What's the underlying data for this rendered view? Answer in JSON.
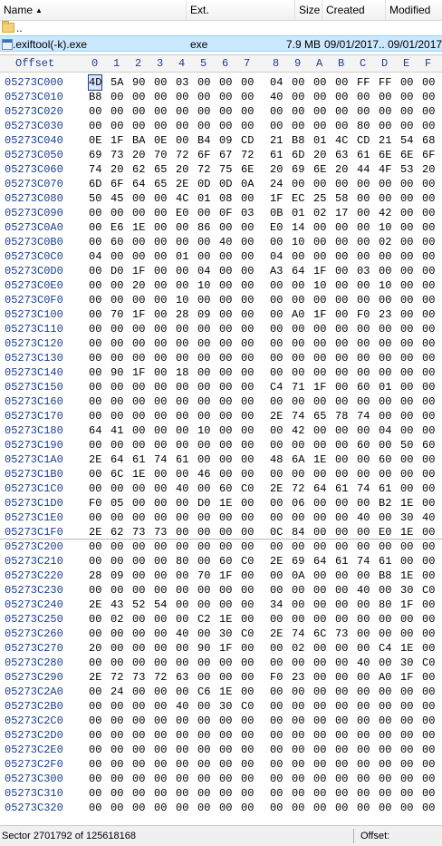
{
  "file_list": {
    "columns": {
      "name": "Name",
      "ext": "Ext.",
      "size": "Size",
      "created": "Created",
      "modified": "Modified"
    },
    "up_row": {
      "name": ".."
    },
    "selected": {
      "name": ".exiftool(-k).exe",
      "ext": "exe",
      "size": "7.9 MB",
      "created": "09/01/2017...",
      "modified": "09/01/2017..."
    }
  },
  "hex": {
    "offset_label": "Offset",
    "columns": [
      "0",
      "1",
      "2",
      "3",
      "4",
      "5",
      "6",
      "7",
      "8",
      "9",
      "A",
      "B",
      "C",
      "D",
      "E",
      "F"
    ],
    "rows": [
      [
        "05273C000",
        "4D 5A 90 00 03 00 00 00 04 00 00 00 FF FF 00 00"
      ],
      [
        "05273C010",
        "B8 00 00 00 00 00 00 00 40 00 00 00 00 00 00 00"
      ],
      [
        "05273C020",
        "00 00 00 00 00 00 00 00 00 00 00 00 00 00 00 00"
      ],
      [
        "05273C030",
        "00 00 00 00 00 00 00 00 00 00 00 00 80 00 00 00"
      ],
      [
        "05273C040",
        "0E 1F BA 0E 00 B4 09 CD 21 B8 01 4C CD 21 54 68"
      ],
      [
        "05273C050",
        "69 73 20 70 72 6F 67 72 61 6D 20 63 61 6E 6E 6F"
      ],
      [
        "05273C060",
        "74 20 62 65 20 72 75 6E 20 69 6E 20 44 4F 53 20"
      ],
      [
        "05273C070",
        "6D 6F 64 65 2E 0D 0D 0A 24 00 00 00 00 00 00 00"
      ],
      [
        "05273C080",
        "50 45 00 00 4C 01 08 00 1F EC 25 58 00 00 00 00"
      ],
      [
        "05273C090",
        "00 00 00 00 E0 00 0F 03 0B 01 02 17 00 42 00 00"
      ],
      [
        "05273C0A0",
        "00 E6 1E 00 00 86 00 00 E0 14 00 00 00 10 00 00"
      ],
      [
        "05273C0B0",
        "00 60 00 00 00 00 40 00 00 10 00 00 00 02 00 00"
      ],
      [
        "05273C0C0",
        "04 00 00 00 01 00 00 00 04 00 00 00 00 00 00 00"
      ],
      [
        "05273C0D0",
        "00 D0 1F 00 00 04 00 00 A3 64 1F 00 03 00 00 00"
      ],
      [
        "05273C0E0",
        "00 00 20 00 00 10 00 00 00 00 10 00 00 10 00 00"
      ],
      [
        "05273C0F0",
        "00 00 00 00 10 00 00 00 00 00 00 00 00 00 00 00"
      ],
      [
        "05273C100",
        "00 70 1F 00 28 09 00 00 00 A0 1F 00 F0 23 00 00"
      ],
      [
        "05273C110",
        "00 00 00 00 00 00 00 00 00 00 00 00 00 00 00 00"
      ],
      [
        "05273C120",
        "00 00 00 00 00 00 00 00 00 00 00 00 00 00 00 00"
      ],
      [
        "05273C130",
        "00 00 00 00 00 00 00 00 00 00 00 00 00 00 00 00"
      ],
      [
        "05273C140",
        "00 90 1F 00 18 00 00 00 00 00 00 00 00 00 00 00"
      ],
      [
        "05273C150",
        "00 00 00 00 00 00 00 00 C4 71 1F 00 60 01 00 00"
      ],
      [
        "05273C160",
        "00 00 00 00 00 00 00 00 00 00 00 00 00 00 00 00"
      ],
      [
        "05273C170",
        "00 00 00 00 00 00 00 00 2E 74 65 78 74 00 00 00"
      ],
      [
        "05273C180",
        "64 41 00 00 00 10 00 00 00 42 00 00 00 04 00 00"
      ],
      [
        "05273C190",
        "00 00 00 00 00 00 00 00 00 00 00 00 60 00 50 60"
      ],
      [
        "05273C1A0",
        "2E 64 61 74 61 00 00 00 48 6A 1E 00 00 60 00 00"
      ],
      [
        "05273C1B0",
        "00 6C 1E 00 00 46 00 00 00 00 00 00 00 00 00 00"
      ],
      [
        "05273C1C0",
        "00 00 00 00 40 00 60 C0 2E 72 64 61 74 61 00 00"
      ],
      [
        "05273C1D0",
        "F0 05 00 00 00 D0 1E 00 00 06 00 00 00 B2 1E 00"
      ],
      [
        "05273C1E0",
        "00 00 00 00 00 00 00 00 00 00 00 00 40 00 30 40"
      ],
      [
        "05273C1F0",
        "2E 62 73 73 00 00 00 00 0C 84 00 00 00 E0 1E 00"
      ],
      [
        "05273C200",
        "00 00 00 00 00 00 00 00 00 00 00 00 00 00 00 00"
      ],
      [
        "05273C210",
        "00 00 00 00 80 00 60 C0 2E 69 64 61 74 61 00 00"
      ],
      [
        "05273C220",
        "28 09 00 00 00 70 1F 00 00 0A 00 00 00 B8 1E 00"
      ],
      [
        "05273C230",
        "00 00 00 00 00 00 00 00 00 00 00 00 40 00 30 C0"
      ],
      [
        "05273C240",
        "2E 43 52 54 00 00 00 00 34 00 00 00 00 80 1F 00"
      ],
      [
        "05273C250",
        "00 02 00 00 00 C2 1E 00 00 00 00 00 00 00 00 00"
      ],
      [
        "05273C260",
        "00 00 00 00 40 00 30 C0 2E 74 6C 73 00 00 00 00"
      ],
      [
        "05273C270",
        "20 00 00 00 00 90 1F 00 00 02 00 00 00 C4 1E 00"
      ],
      [
        "05273C280",
        "00 00 00 00 00 00 00 00 00 00 00 00 40 00 30 C0"
      ],
      [
        "05273C290",
        "2E 72 73 72 63 00 00 00 F0 23 00 00 00 A0 1F 00"
      ],
      [
        "05273C2A0",
        "00 24 00 00 00 C6 1E 00 00 00 00 00 00 00 00 00"
      ],
      [
        "05273C2B0",
        "00 00 00 00 40 00 30 C0 00 00 00 00 00 00 00 00"
      ],
      [
        "05273C2C0",
        "00 00 00 00 00 00 00 00 00 00 00 00 00 00 00 00"
      ],
      [
        "05273C2D0",
        "00 00 00 00 00 00 00 00 00 00 00 00 00 00 00 00"
      ],
      [
        "05273C2E0",
        "00 00 00 00 00 00 00 00 00 00 00 00 00 00 00 00"
      ],
      [
        "05273C2F0",
        "00 00 00 00 00 00 00 00 00 00 00 00 00 00 00 00"
      ],
      [
        "05273C300",
        "00 00 00 00 00 00 00 00 00 00 00 00 00 00 00 00"
      ],
      [
        "05273C310",
        "00 00 00 00 00 00 00 00 00 00 00 00 00 00 00 00"
      ],
      [
        "05273C320",
        "00 00 00 00 00 00 00 00 00 00 00 00 00 00 00 00"
      ]
    ]
  },
  "status": {
    "sector": "Sector 2701792 of 125618168",
    "offset": "Offset:"
  },
  "colors": {
    "offset_text": "#1a3f8f",
    "selection": "#cce8ff"
  }
}
